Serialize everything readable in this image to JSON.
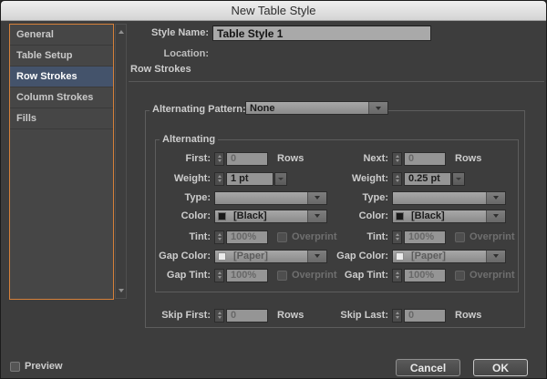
{
  "window": {
    "title": "New Table Style"
  },
  "sidebar": {
    "items": [
      {
        "label": "General",
        "selected": false
      },
      {
        "label": "Table Setup",
        "selected": false
      },
      {
        "label": "Row Strokes",
        "selected": true
      },
      {
        "label": "Column Strokes",
        "selected": false
      },
      {
        "label": "Fills",
        "selected": false
      }
    ]
  },
  "general": {
    "style_name_label": "Style Name:",
    "style_name_value": "Table Style 1",
    "location_label": "Location:"
  },
  "section": {
    "title": "Row Strokes"
  },
  "alternating_pattern": {
    "label": "Alternating Pattern:",
    "value": "None"
  },
  "alternating": {
    "group_label": "Alternating",
    "left": {
      "count_label": "First:",
      "count_value": "0",
      "count_unit": "Rows",
      "weight_label": "Weight:",
      "weight_value": "1 pt",
      "type_label": "Type:",
      "color_label": "Color:",
      "color_value": "[Black]",
      "tint_label": "Tint:",
      "tint_value": "100%",
      "overprint_label": "Overprint",
      "gap_color_label": "Gap Color:",
      "gap_color_value": "[Paper]",
      "gap_tint_label": "Gap Tint:",
      "gap_tint_value": "100%",
      "gap_overprint_label": "Overprint"
    },
    "right": {
      "count_label": "Next:",
      "count_value": "0",
      "count_unit": "Rows",
      "weight_label": "Weight:",
      "weight_value": "0.25 pt",
      "type_label": "Type:",
      "color_label": "Color:",
      "color_value": "[Black]",
      "tint_label": "Tint:",
      "tint_value": "100%",
      "overprint_label": "Overprint",
      "gap_color_label": "Gap Color:",
      "gap_color_value": "[Paper]",
      "gap_tint_label": "Gap Tint:",
      "gap_tint_value": "100%",
      "gap_overprint_label": "Overprint"
    }
  },
  "skip": {
    "first_label": "Skip First:",
    "first_value": "0",
    "first_unit": "Rows",
    "last_label": "Skip Last:",
    "last_value": "0",
    "last_unit": "Rows"
  },
  "footer": {
    "preview_label": "Preview",
    "cancel_label": "Cancel",
    "ok_label": "OK"
  },
  "icons": {
    "dropdown_arrow": "chevron-down",
    "stepper": "up-down-arrows",
    "scrollbar": "up-down-arrows",
    "black_swatch": "black-color-swatch",
    "paper_swatch": "paper-color-swatch"
  },
  "colors": {
    "focus_ring_orange": "#d6813a",
    "selected_item_blue": "#44536b",
    "dialog_background": "#3d3d3d",
    "black_swatch": "#191919",
    "paper_swatch": "#ebebeb"
  }
}
